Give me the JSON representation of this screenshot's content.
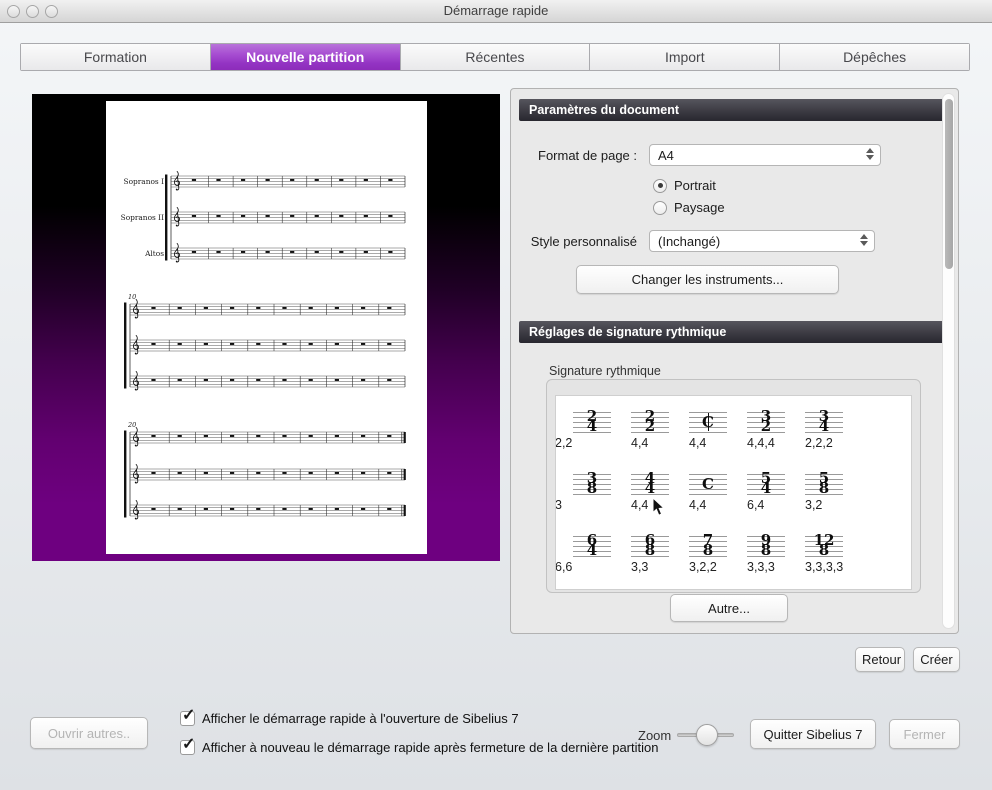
{
  "window": {
    "title": "Démarrage rapide"
  },
  "tabs": [
    {
      "label": "Formation",
      "selected": false
    },
    {
      "label": "Nouvelle partition",
      "selected": true
    },
    {
      "label": "Récentes",
      "selected": false
    },
    {
      "label": "Import",
      "selected": false
    },
    {
      "label": "Dépêches",
      "selected": false
    }
  ],
  "preview": {
    "staff_labels": [
      "Sopranos I",
      "Sopranos II",
      "Altos"
    ],
    "bar_numbers": [
      "10",
      "20"
    ]
  },
  "panel": {
    "document_section_title": "Paramètres du document",
    "page_format": {
      "label": "Format de page :",
      "value": "A4"
    },
    "orientation": {
      "portrait": "Portrait",
      "paysage": "Paysage",
      "selected": "Portrait"
    },
    "custom_style": {
      "label": "Style personnalisé",
      "value": "(Inchangé)"
    },
    "change_instruments_label": "Changer les instruments...",
    "rhythm_section_title": "Réglages de signature rythmique",
    "time_signature": {
      "group_label": "Signature rythmique",
      "items": [
        {
          "num": "2",
          "den": "4",
          "label": "2,2"
        },
        {
          "num": "2",
          "den": "2",
          "label": "4,4"
        },
        {
          "symbol": "cut",
          "label": "4,4"
        },
        {
          "num": "3",
          "den": "2",
          "label": "4,4,4"
        },
        {
          "num": "3",
          "den": "4",
          "label": "2,2,2"
        },
        {
          "num": "3",
          "den": "8",
          "label": "3"
        },
        {
          "num": "4",
          "den": "4",
          "label": "4,4"
        },
        {
          "symbol": "common",
          "label": "4,4"
        },
        {
          "num": "5",
          "den": "4",
          "label": "6,4"
        },
        {
          "num": "5",
          "den": "8",
          "label": "3,2"
        },
        {
          "num": "6",
          "den": "4",
          "label": "6,6"
        },
        {
          "num": "6",
          "den": "8",
          "label": "3,3"
        },
        {
          "num": "7",
          "den": "8",
          "label": "3,2,2"
        },
        {
          "num": "9",
          "den": "8",
          "label": "3,3,3"
        },
        {
          "num": "12",
          "den": "8",
          "label": "3,3,3,3"
        }
      ],
      "other_label": "Autre..."
    }
  },
  "actions": {
    "back": "Retour",
    "create": "Créer"
  },
  "footer": {
    "open_others": "Ouvrir autres..",
    "checkbox_show_on_launch": "Afficher le démarrage rapide à l'ouverture de Sibelius 7",
    "checkbox_show_after_close": "Afficher à nouveau le démarrage rapide après fermeture de la dernière partition",
    "zoom_label": "Zoom",
    "quit": "Quitter Sibelius 7",
    "close": "Fermer"
  },
  "colors": {
    "accent_purple": "#9333c3",
    "preview_purple": "#6e0080"
  }
}
